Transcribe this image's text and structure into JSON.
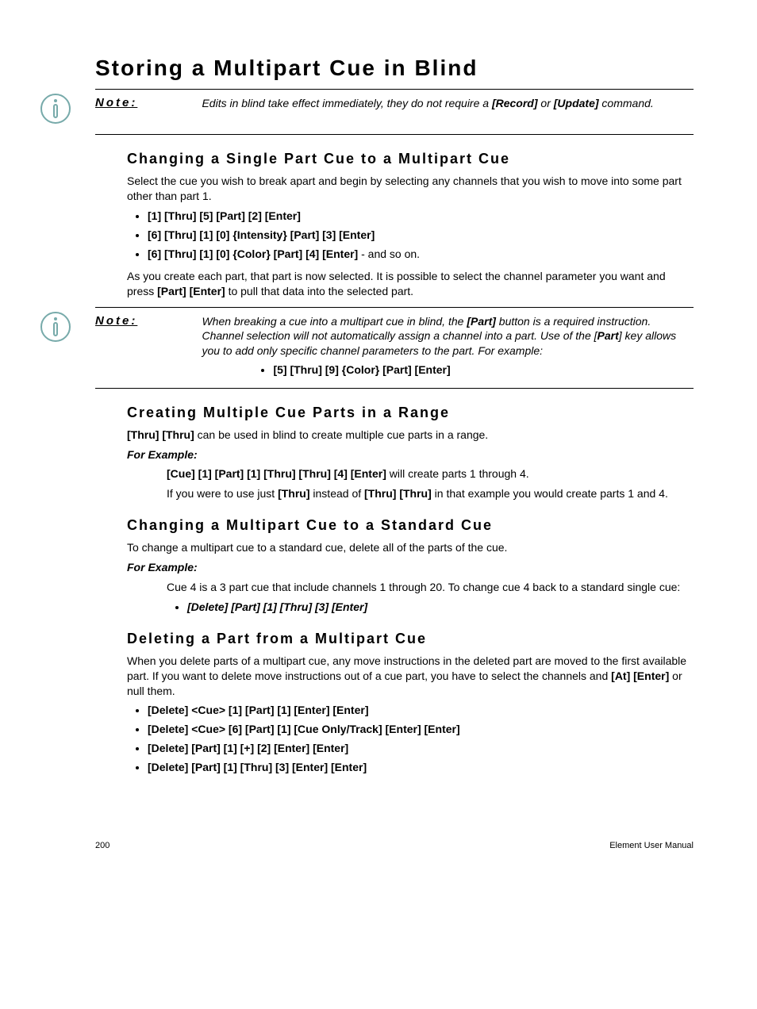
{
  "page_title": "Storing a Multipart Cue in Blind",
  "note1": {
    "label": "Note:",
    "body_pre": "Edits in blind take effect immediately, they do not require a ",
    "bold1": "[Record]",
    "mid": " or ",
    "bold2": "[Update]",
    "body_post": " command."
  },
  "sec1": {
    "heading": "Changing a Single Part Cue to a Multipart Cue",
    "p1": "Select the cue you wish to break apart and begin by selecting any channels that you wish to move into some part other than part 1.",
    "cmds": [
      "[1] [Thru] [5] [Part] [2] [Enter]",
      "[6] [Thru] [1] [0] {Intensity} [Part] [3] [Enter]"
    ],
    "cmd3_bold": "[6] [Thru] [1] [0] {Color} [Part] [4] [Enter]",
    "cmd3_tail": " - and so on.",
    "p2_pre": "As you create each part, that part is now selected. It is possible to select the channel parameter you want and press ",
    "p2_bold": "[Part] [Enter]",
    "p2_post": " to pull that data into the selected part."
  },
  "note2": {
    "label": "Note:",
    "l1_pre": "When breaking a cue into a multipart cue in blind, the ",
    "l1_bold": "[Part]",
    "l1_post": " button is a required instruction. Channel selection will not automatically assign a channel into a part. Use of the [",
    "l2_bold": "Part",
    "l2_post": "] key allows you to add only specific channel parameters to the part. For example:",
    "cmd": "[5] [Thru] [9] {Color} [Part] [Enter]"
  },
  "sec2": {
    "heading": "Creating Multiple Cue Parts in a Range",
    "p1_bold": "[Thru] [Thru]",
    "p1_post": " can be used in blind to create multiple cue parts in a range.",
    "example_label": "For Example:",
    "ex_bold": "[Cue] [1] [Part] [1] [Thru] [Thru] [4] [Enter]",
    "ex_tail": " will create parts 1 through 4.",
    "ex2_pre": "If you were to use just ",
    "ex2_b1": "[Thru]",
    "ex2_mid": " instead of ",
    "ex2_b2": "[Thru] [Thru]",
    "ex2_post": " in that example you would create parts 1 and 4."
  },
  "sec3": {
    "heading": "Changing a Multipart Cue to a Standard Cue",
    "p1": "To change a multipart cue to a standard cue, delete all of the parts of the cue.",
    "example_label": "For Example:",
    "ex_p": "Cue 4 is a 3 part cue that include channels 1 through 20. To change cue 4 back to a standard single cue:",
    "ex_cmd": "[Delete] [Part] [1] [Thru] [3] [Enter]"
  },
  "sec4": {
    "heading": "Deleting a Part from a Multipart Cue",
    "p1_pre": "When you delete parts of a multipart cue, any move instructions in the deleted part are moved to the first available part. If you want to delete move instructions out of a cue part, you have to select the channels and ",
    "p1_bold": "[At] [Enter]",
    "p1_post": " or null them.",
    "cmds": [
      "[Delete] <Cue> [1] [Part] [1] [Enter] [Enter]",
      "[Delete] <Cue> [6] [Part] [1] [Cue Only/Track] [Enter] [Enter]",
      "[Delete] [Part] [1] [+] [2] [Enter] [Enter]",
      "[Delete] [Part] [1] [Thru] [3] [Enter] [Enter]"
    ]
  },
  "footer": {
    "page": "200",
    "doc": "Element User Manual"
  }
}
